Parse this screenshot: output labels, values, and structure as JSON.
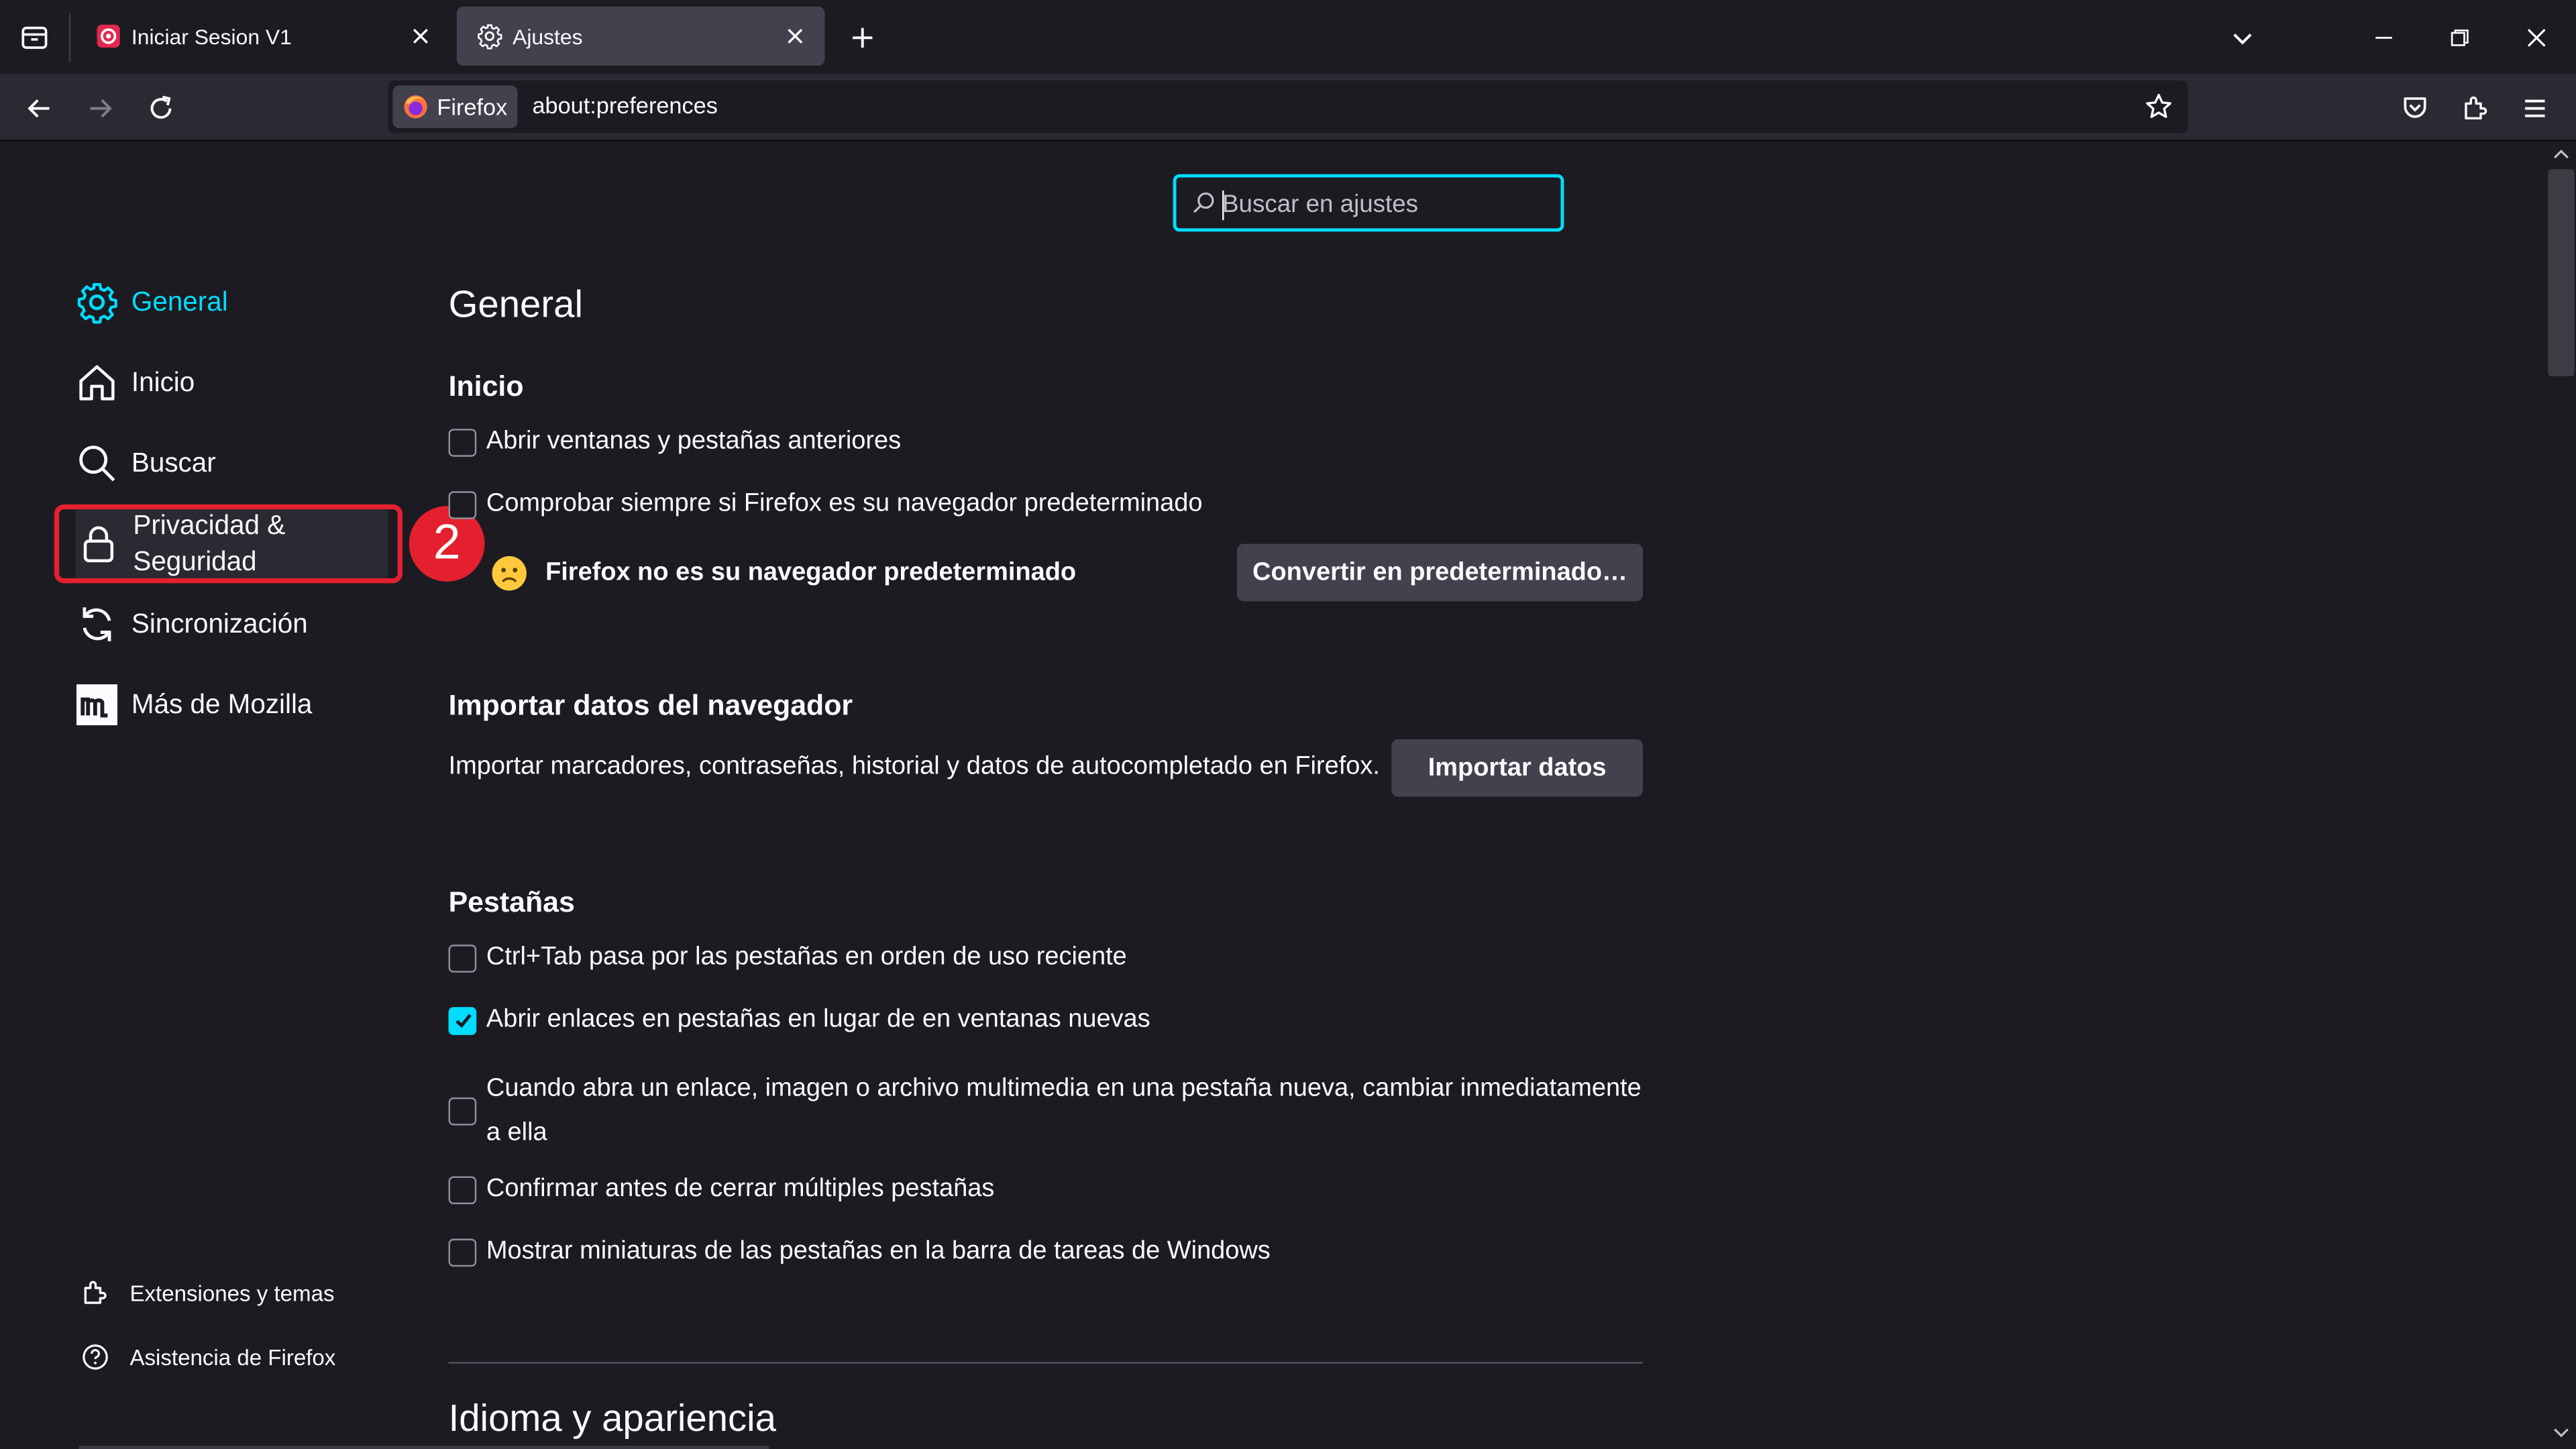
{
  "tabs": [
    {
      "label": "Iniciar Sesion V1",
      "active": false
    },
    {
      "label": "Ajustes",
      "active": true
    }
  ],
  "urlbar": {
    "identity_label": "Firefox",
    "url": "about:preferences"
  },
  "search": {
    "placeholder": "Buscar en ajustes"
  },
  "sidebar": {
    "items": [
      {
        "label": "General"
      },
      {
        "label": "Inicio"
      },
      {
        "label": "Buscar"
      },
      {
        "label": "Privacidad & Seguridad"
      },
      {
        "label": "Sincronización"
      },
      {
        "label": "Más de Mozilla"
      }
    ],
    "footer": [
      {
        "label": "Extensiones y temas"
      },
      {
        "label": "Asistencia de Firefox"
      }
    ],
    "highlight_badge": "2"
  },
  "main": {
    "title": "General",
    "startup": {
      "heading": "Inicio",
      "restore_session": "Abrir ventanas y pestañas anteriores",
      "check_default": "Comprobar siempre si Firefox es su navegador predeterminado",
      "not_default_msg": "Firefox no es su navegador predeterminado",
      "set_default_button": "Convertir en predeterminado…"
    },
    "import": {
      "heading": "Importar datos del navegador",
      "description": "Importar marcadores, contraseñas, historial y datos de autocompletado en Firefox.",
      "button": "Importar datos"
    },
    "tabs": {
      "heading": "Pestañas",
      "options": [
        {
          "label": "Ctrl+Tab pasa por las pestañas en orden de uso reciente",
          "checked": false
        },
        {
          "label": "Abrir enlaces en pestañas en lugar de en ventanas nuevas",
          "checked": true
        },
        {
          "label": "Cuando abra un enlace, imagen o archivo multimedia en una pestaña nueva, cambiar inmediatamente a ella",
          "checked": false
        },
        {
          "label": "Confirmar antes de cerrar múltiples pestañas",
          "checked": false
        },
        {
          "label": "Mostrar miniaturas de las pestañas en la barra de tareas de Windows",
          "checked": false
        }
      ]
    },
    "language": {
      "heading": "Idioma y apariencia"
    }
  },
  "colors": {
    "accent": "#00ddff",
    "highlight": "#e5202e",
    "background": "#1c1b22"
  }
}
